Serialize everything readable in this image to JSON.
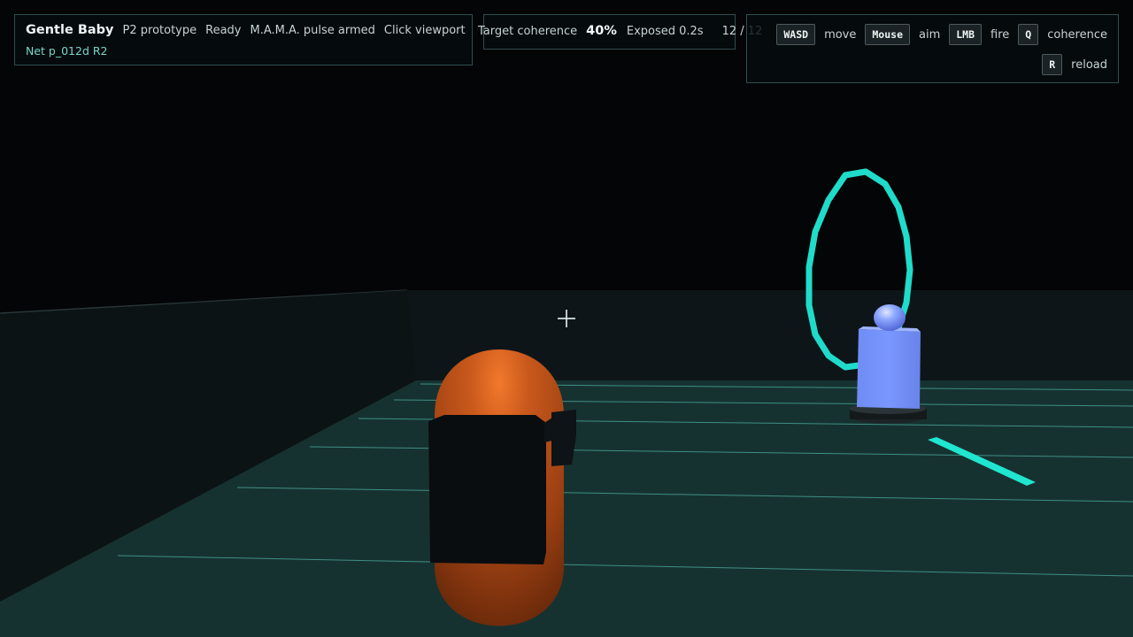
{
  "hud": {
    "title": "Gentle Baby",
    "prototype": "P2 prototype",
    "ready": "Ready",
    "pulse": "M.A.M.A. pulse armed",
    "hint": "Click viewport",
    "net": "Net p_012d R2"
  },
  "coherence": {
    "label": "Target coherence",
    "value": "40%",
    "exposed": "Exposed 0.2s",
    "ammo": "12 / 12"
  },
  "controls": [
    {
      "key": "WASD",
      "action": "move"
    },
    {
      "key": "Mouse",
      "action": "aim"
    },
    {
      "key": "LMB",
      "action": "fire"
    },
    {
      "key": "Q",
      "action": "coherence"
    },
    {
      "key": "R",
      "action": "reload"
    }
  ],
  "colors": {
    "accent": "#20e6d0",
    "player": "#c4571a",
    "target": "#7a95ff",
    "floor": "#163230"
  }
}
